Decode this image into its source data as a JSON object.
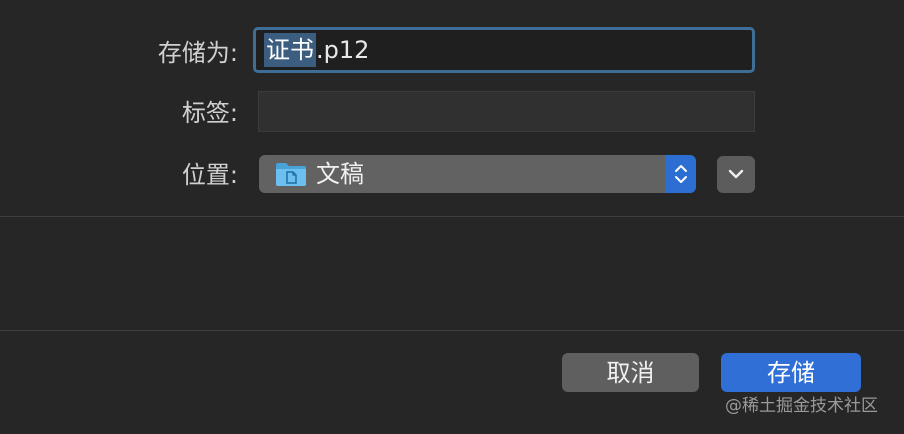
{
  "form": {
    "save_as_label": "存储为:",
    "tags_label": "标签:",
    "where_label": "位置:",
    "filename_selected": "证书",
    "filename_extension": ".p12",
    "tags_value": "",
    "location": "文稿"
  },
  "buttons": {
    "cancel": "取消",
    "save": "存储"
  },
  "watermark": "@稀土掘金技术社区",
  "colors": {
    "background": "#262626",
    "accent": "#2f6fd6",
    "focus_ring": "#3d6e97",
    "selection": "#3b5d80",
    "folder": "#4aa3d8"
  },
  "icons": {
    "folder": "folder-icon",
    "stepper": "up-down-chevron-icon",
    "expand": "chevron-down-icon"
  }
}
